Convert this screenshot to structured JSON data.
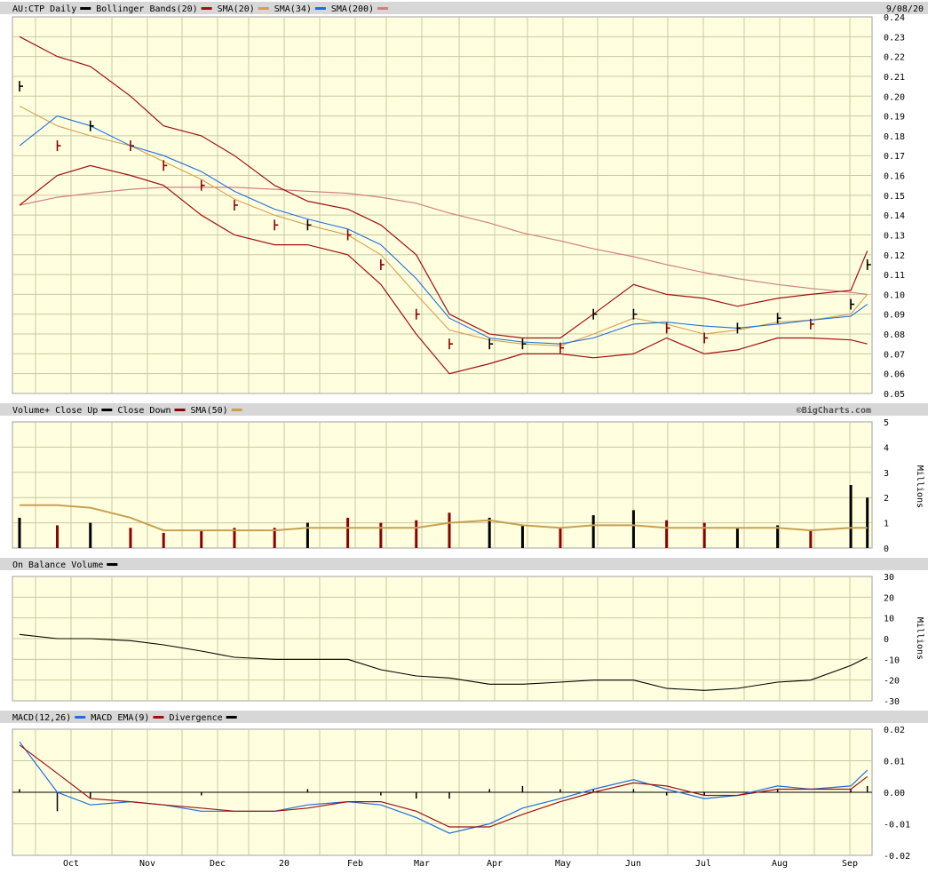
{
  "colors": {
    "background": "#ffffe0",
    "header": "#d7d7d7",
    "grid": "#c8c8a0",
    "up": "#000000",
    "down": "#8b0000",
    "bollinger": "#a01010",
    "sma20": "#a01010",
    "sma34": "#d4a050",
    "sma200": "#d08080",
    "sma50_volume": "#c8a050",
    "macd_line": "#1e6fd9",
    "macd_ema": "#a01010"
  },
  "date_label": "9/08/20",
  "watermark": "©BigCharts.com",
  "x_axis": {
    "labels": [
      "Oct",
      "Nov",
      "Dec",
      "20",
      "Feb",
      "Mar",
      "Apr",
      "May",
      "Jun",
      "Jul",
      "Aug",
      "Sep"
    ]
  },
  "panels": {
    "price": {
      "legend": [
        {
          "text": "AU:CTP Daily",
          "swatch": "#000000"
        },
        {
          "text": "Bollinger Bands(20)",
          "swatch": "#a01010"
        },
        {
          "text": "SMA(20)",
          "swatch": "#d4a050"
        },
        {
          "text": "SMA(34)",
          "swatch": "#1e6fd9"
        },
        {
          "text": "SMA(200)",
          "swatch": "#d08080"
        }
      ],
      "y_ticks": [
        "0.24",
        "0.23",
        "0.22",
        "0.21",
        "0.20",
        "0.19",
        "0.18",
        "0.17",
        "0.16",
        "0.15",
        "0.14",
        "0.13",
        "0.12",
        "0.11",
        "0.10",
        "0.09",
        "0.08",
        "0.07",
        "0.06",
        "0.05"
      ]
    },
    "volume": {
      "legend": [
        {
          "text": "Volume+ Close Up",
          "swatch": "#000000"
        },
        {
          "text": "Close Down",
          "swatch": "#8b0000"
        },
        {
          "text": "SMA(50)",
          "swatch": "#c8a050"
        }
      ],
      "y_ticks": [
        "5",
        "4",
        "3",
        "2",
        "1",
        "0"
      ],
      "unit": "Millions"
    },
    "obv": {
      "legend": [
        {
          "text": "On Balance Volume",
          "swatch": "#000000"
        }
      ],
      "y_ticks": [
        "30",
        "20",
        "10",
        "0",
        "-10",
        "-20",
        "-30"
      ],
      "unit": "Millions"
    },
    "macd": {
      "legend": [
        {
          "text": "MACD(12,26)",
          "swatch": "#1e6fd9"
        },
        {
          "text": "MACD EMA(9)",
          "swatch": "#a01010"
        },
        {
          "text": "Divergence",
          "swatch": "#000000"
        }
      ],
      "y_ticks": [
        "0.02",
        "0.01",
        "0.00",
        "-0.01",
        "-0.02"
      ]
    }
  },
  "chart_data": {
    "type": "line",
    "title": "AU:CTP Daily",
    "period": "Sep 2019 - Sep 2020",
    "x": [
      "2019-09-15",
      "2019-10-01",
      "2019-10-15",
      "2019-11-01",
      "2019-11-15",
      "2019-12-01",
      "2019-12-15",
      "2020-01-01",
      "2020-01-15",
      "2020-02-01",
      "2020-02-15",
      "2020-03-01",
      "2020-03-15",
      "2020-04-01",
      "2020-04-15",
      "2020-05-01",
      "2020-05-15",
      "2020-06-01",
      "2020-06-15",
      "2020-07-01",
      "2020-07-15",
      "2020-08-01",
      "2020-08-15",
      "2020-09-01",
      "2020-09-08"
    ],
    "series": [
      {
        "name": "AU:CTP Daily",
        "values": [
          0.205,
          0.175,
          0.185,
          0.175,
          0.165,
          0.155,
          0.145,
          0.135,
          0.135,
          0.13,
          0.115,
          0.09,
          0.075,
          0.075,
          0.075,
          0.073,
          0.09,
          0.09,
          0.083,
          0.078,
          0.083,
          0.088,
          0.085,
          0.095,
          0.115
        ]
      },
      {
        "name": "SMA(20)",
        "values": [
          0.195,
          0.185,
          0.18,
          0.175,
          0.167,
          0.158,
          0.148,
          0.14,
          0.135,
          0.13,
          0.12,
          0.1,
          0.082,
          0.077,
          0.075,
          0.074,
          0.08,
          0.088,
          0.085,
          0.08,
          0.082,
          0.086,
          0.087,
          0.09,
          0.1
        ]
      },
      {
        "name": "SMA(34)",
        "values": [
          0.175,
          0.19,
          0.185,
          0.175,
          0.17,
          0.162,
          0.152,
          0.143,
          0.138,
          0.133,
          0.125,
          0.108,
          0.088,
          0.078,
          0.076,
          0.075,
          0.078,
          0.085,
          0.086,
          0.084,
          0.083,
          0.085,
          0.087,
          0.089,
          0.095
        ]
      },
      {
        "name": "SMA(200)",
        "values": [
          0.145,
          0.149,
          0.151,
          0.153,
          0.154,
          0.154,
          0.154,
          0.153,
          0.152,
          0.151,
          0.149,
          0.146,
          0.141,
          0.136,
          0.131,
          0.127,
          0.123,
          0.119,
          0.115,
          0.111,
          0.108,
          0.105,
          0.103,
          0.101,
          0.1
        ]
      },
      {
        "name": "Bollinger Upper",
        "values": [
          0.23,
          0.22,
          0.215,
          0.2,
          0.185,
          0.18,
          0.17,
          0.155,
          0.147,
          0.143,
          0.135,
          0.12,
          0.09,
          0.08,
          0.078,
          0.078,
          0.09,
          0.105,
          0.1,
          0.098,
          0.094,
          0.098,
          0.1,
          0.102,
          0.122
        ]
      },
      {
        "name": "Bollinger Lower",
        "values": [
          0.145,
          0.16,
          0.165,
          0.16,
          0.155,
          0.14,
          0.13,
          0.125,
          0.125,
          0.12,
          0.105,
          0.08,
          0.06,
          0.065,
          0.07,
          0.07,
          0.068,
          0.07,
          0.078,
          0.07,
          0.072,
          0.078,
          0.078,
          0.077,
          0.075
        ]
      },
      {
        "name": "Volume",
        "values": [
          1.2,
          0.9,
          1.0,
          0.8,
          0.6,
          0.7,
          0.8,
          0.8,
          1.0,
          1.2,
          1.0,
          1.1,
          1.4,
          1.2,
          0.9,
          0.8,
          1.3,
          1.5,
          1.1,
          1.0,
          0.8,
          0.9,
          0.7,
          2.5,
          2.0
        ]
      },
      {
        "name": "Volume SMA(50)",
        "values": [
          1.7,
          1.7,
          1.6,
          1.2,
          0.7,
          0.7,
          0.7,
          0.7,
          0.8,
          0.8,
          0.8,
          0.8,
          1.0,
          1.1,
          0.9,
          0.8,
          0.9,
          0.9,
          0.8,
          0.8,
          0.8,
          0.8,
          0.7,
          0.8,
          0.8
        ]
      },
      {
        "name": "On Balance Volume",
        "values": [
          2,
          0,
          0,
          -1,
          -3,
          -6,
          -9,
          -10,
          -10,
          -10,
          -15,
          -18,
          -19,
          -22,
          -22,
          -21,
          -20,
          -20,
          -24,
          -25,
          -24,
          -21,
          -20,
          -13,
          -9
        ]
      },
      {
        "name": "MACD(12,26)",
        "values": [
          0.016,
          0.0,
          -0.004,
          -0.003,
          -0.004,
          -0.006,
          -0.006,
          -0.006,
          -0.004,
          -0.003,
          -0.004,
          -0.008,
          -0.013,
          -0.01,
          -0.005,
          -0.002,
          0.001,
          0.004,
          0.001,
          -0.002,
          -0.001,
          0.002,
          0.001,
          0.002,
          0.007
        ]
      },
      {
        "name": "MACD EMA(9)",
        "values": [
          0.015,
          0.006,
          -0.002,
          -0.003,
          -0.004,
          -0.005,
          -0.006,
          -0.006,
          -0.005,
          -0.003,
          -0.003,
          -0.006,
          -0.011,
          -0.011,
          -0.007,
          -0.003,
          0.0,
          0.003,
          0.002,
          -0.001,
          -0.001,
          0.001,
          0.001,
          0.001,
          0.005
        ]
      }
    ],
    "ylim": [
      0.05,
      0.24
    ],
    "grid": true,
    "legend": "top-left"
  }
}
